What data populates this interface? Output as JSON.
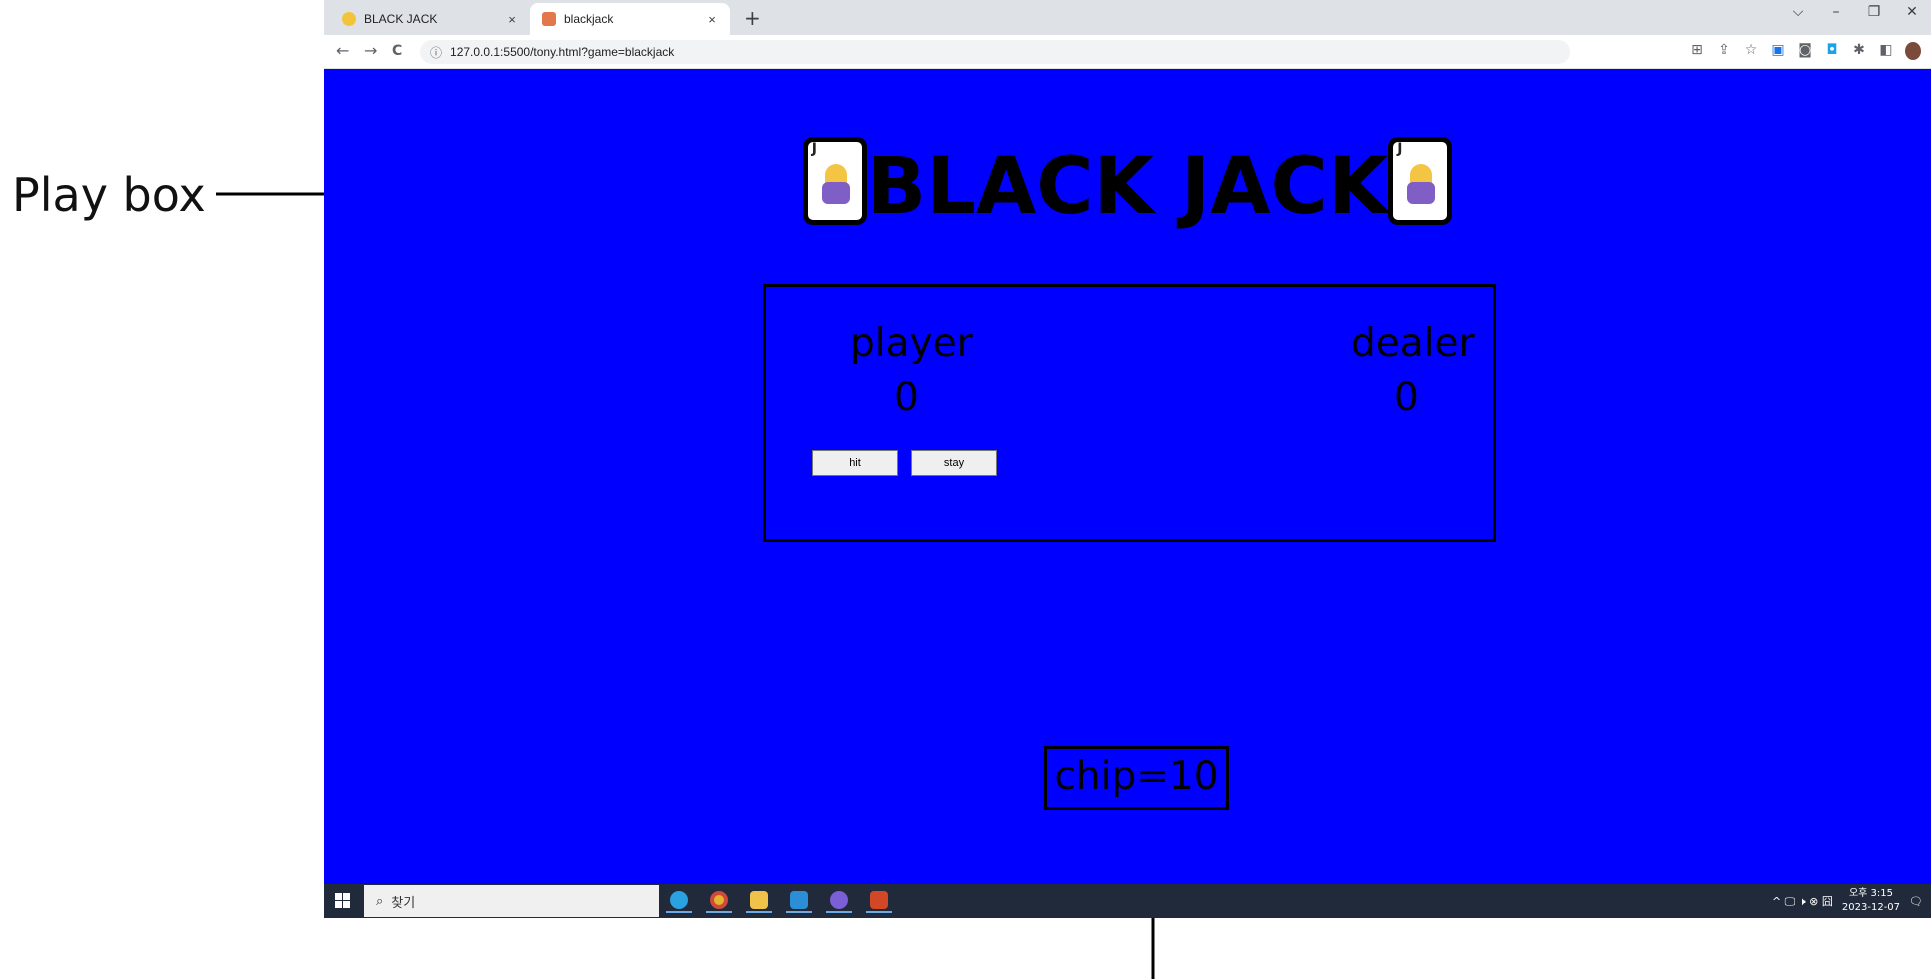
{
  "annotations": {
    "play_box_label": "Play box"
  },
  "browser": {
    "tabs": [
      {
        "title": "BLACK JACK",
        "close": "×"
      },
      {
        "title": "blackjack",
        "close": "×"
      }
    ],
    "new_tab": "+",
    "window_controls": [
      "⌵",
      "–",
      "❐",
      "✕"
    ],
    "nav": {
      "back": "←",
      "forward": "→",
      "reload": "C"
    },
    "url": "127.0.0.1:5500/tony.html?game=blackjack",
    "info_icon": "ⓘ"
  },
  "game": {
    "title": "BLACK JACK",
    "card_icon": "joker-card-icon",
    "card_letter": "J",
    "player_label": "player",
    "dealer_label": "dealer",
    "player_score": "0",
    "dealer_score": "0",
    "hit_label": "hit",
    "stay_label": "stay",
    "chip_text": "chip=10"
  },
  "taskbar": {
    "search_placeholder": "찾기",
    "apps": [
      "edge-icon",
      "chrome-icon",
      "file-explorer-icon",
      "vscode-icon",
      "github-icon",
      "powerpoint-icon"
    ],
    "tray_icons": "^ 🖵 🕨 ⊗ 囧",
    "time": "오후 3:15",
    "date": "2023-12-07"
  },
  "colors": {
    "page_background": "#0000ff",
    "tab_strip": "#dee1e6",
    "taskbar": "#202a3a"
  }
}
